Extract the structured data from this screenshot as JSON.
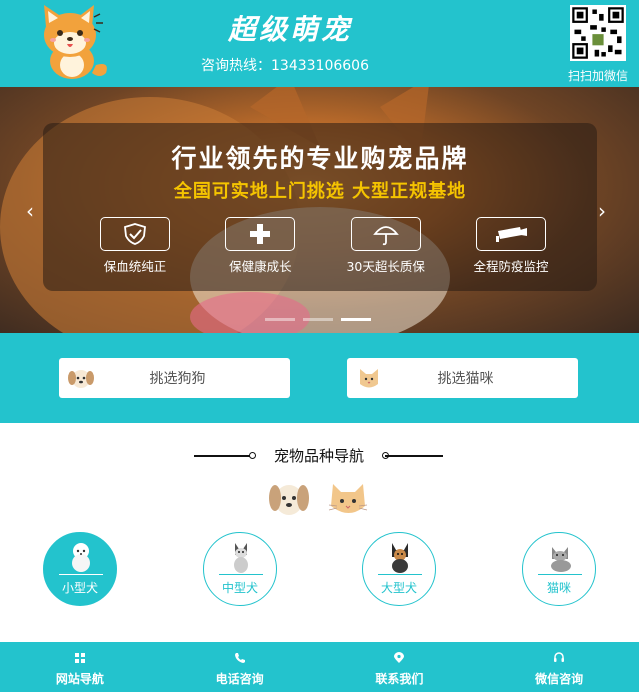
{
  "header": {
    "brand": "超级萌宠",
    "hotline": "咨询热线：13433106606",
    "qr_label": "扫扫加微信",
    "logo_icon": "shiba-dog-logo-icon",
    "qr_icon": "wechat-qr-code-icon"
  },
  "banner": {
    "slogan": "行业领先的专业购宠品牌",
    "sub_slogan": "全国可实地上门挑选  大型正规基地",
    "features": [
      {
        "label": "保血统纯正",
        "icon": "shield-check-icon"
      },
      {
        "label": "保健康成长",
        "icon": "plus-cross-icon"
      },
      {
        "label": "30天超长质保",
        "icon": "umbrella-icon"
      },
      {
        "label": "全程防疫监控",
        "icon": "camera-monitor-icon"
      }
    ],
    "prev_arrow": "‹",
    "next_arrow": "›",
    "slides": 3,
    "active_slide": 3
  },
  "choose": {
    "dog_label": "挑选狗狗",
    "cat_label": "挑选猫咪",
    "dog_icon": "puppy-face-icon",
    "cat_icon": "kitten-face-icon"
  },
  "nav": {
    "title": "宠物品种导航",
    "categories": [
      {
        "label": "小型犬",
        "icon": "small-dog-icon",
        "active": true
      },
      {
        "label": "中型犬",
        "icon": "medium-dog-icon",
        "active": false
      },
      {
        "label": "大型犬",
        "icon": "large-dog-icon",
        "active": false
      },
      {
        "label": "猫咪",
        "icon": "cat-icon",
        "active": false
      }
    ]
  },
  "footer": {
    "items": [
      {
        "label": "网站导航",
        "icon": "grid-icon"
      },
      {
        "label": "电话咨询",
        "icon": "phone-icon"
      },
      {
        "label": "联系我们",
        "icon": "location-pin-icon"
      },
      {
        "label": "微信咨询",
        "icon": "headset-icon"
      }
    ]
  },
  "colors": {
    "primary": "#23c3cd",
    "accent_yellow": "#f5c400",
    "white": "#ffffff"
  }
}
